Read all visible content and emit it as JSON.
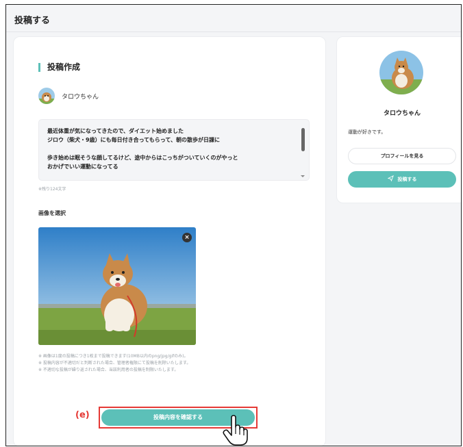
{
  "header": {
    "title": "投稿する"
  },
  "compose": {
    "section_title": "投稿作成",
    "user_name": "タロウちゃん",
    "text_lines": [
      "最近体重が気になってきたので、ダイエット始めました",
      "ジロウ（柴犬・9歳）にも毎日付き合ってもらって、朝の散歩が日課に",
      "",
      "歩き始めは眠そうな顔してるけど、途中からはこっちがついていくのがやっと",
      "おかげでいい運動になってる"
    ],
    "char_remaining": "※残り124文字",
    "image_label": "画像を選択",
    "remove_icon": "×",
    "notes": [
      "※ 画像は1度の投稿につき1枚まで投稿できます(10MB以内のpng/jpg/gifのみ)。",
      "※ 投稿内容が不適切だと判断された場合、管理者権限にて投稿を削除いたします。",
      "※ 不適切な投稿が繰り返された場合、当該利用者の投稿を制限いたします。"
    ],
    "confirm_button": "投稿内容を確認する",
    "callout": "(e)"
  },
  "profile": {
    "name": "タロウちゃん",
    "bio": "運動が好きです。",
    "view_profile_button": "プロフィールを見る",
    "post_button": "投稿する"
  },
  "colors": {
    "accent": "#5cc0b8",
    "highlight": "#e53935"
  },
  "icons": {
    "post": "paper-plane-icon",
    "remove": "close-icon",
    "cursor": "hand-pointer-icon"
  }
}
